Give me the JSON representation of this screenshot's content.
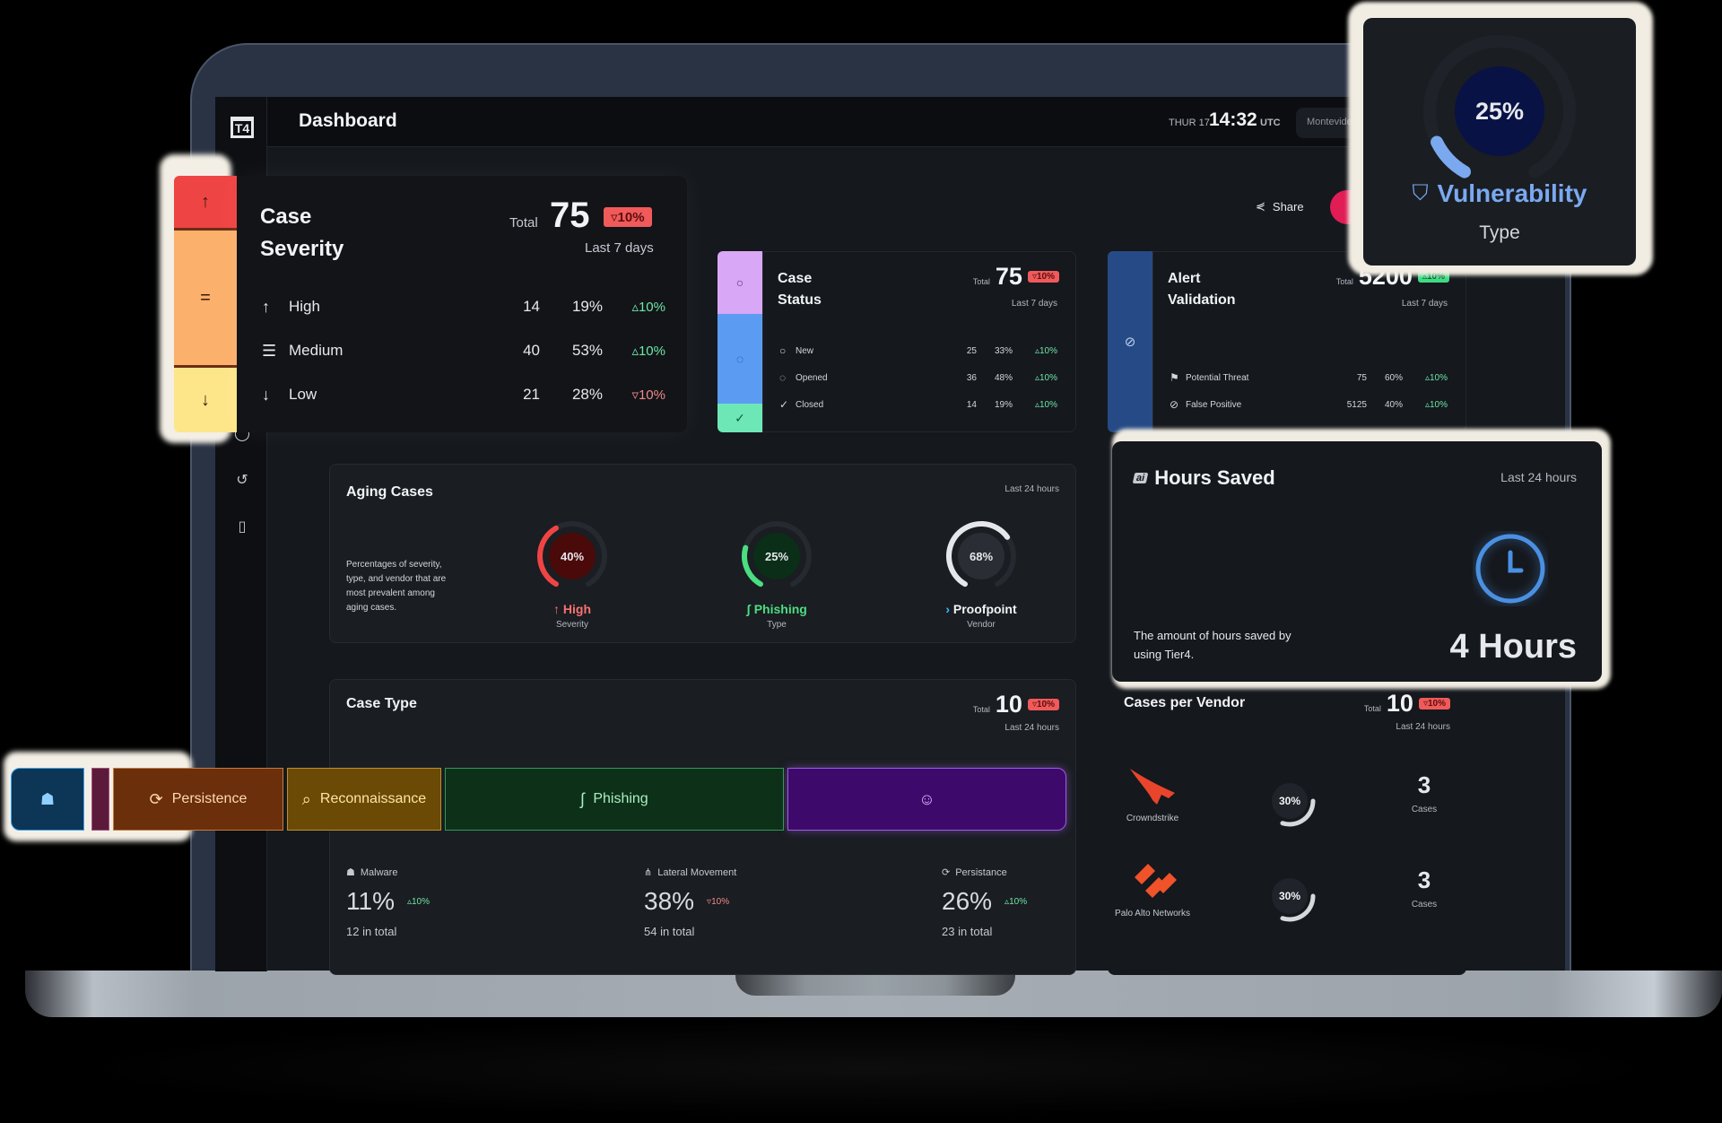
{
  "app": {
    "logo_text": "T4",
    "page_title": "Dashboard"
  },
  "header": {
    "day": "THUR 17",
    "time": "14:32",
    "timezone": "UTC",
    "location": "Montevideo,",
    "share_label": "Share",
    "download_icon": "download-icon"
  },
  "sidebar": {
    "icons": [
      "history-icon",
      "document-icon"
    ]
  },
  "case_severity": {
    "title_line1": "Case",
    "title_line2": "Severity",
    "total_label": "Total",
    "total": "75",
    "change": "▿10%",
    "period": "Last 7 days",
    "strip_colors": [
      "#ef4444",
      "#fbb06b",
      "#fde68a"
    ],
    "rows": [
      {
        "icon": "↑",
        "label": "High",
        "count": "14",
        "pct": "19%",
        "change": "▵10%",
        "dir": "up"
      },
      {
        "icon": "☰",
        "label": "Medium",
        "count": "40",
        "pct": "53%",
        "change": "▵10%",
        "dir": "up"
      },
      {
        "icon": "↓",
        "label": "Low",
        "count": "21",
        "pct": "28%",
        "change": "▿10%",
        "dir": "down"
      }
    ]
  },
  "case_status": {
    "title_line1": "Case",
    "title_line2": "Status",
    "total_label": "Total",
    "total": "75",
    "change": "▿10%",
    "period": "Last 7 days",
    "strip_colors": [
      "#d8a7f5",
      "#5b9cf2",
      "#6ee7b7"
    ],
    "rows": [
      {
        "icon": "○",
        "label": "New",
        "count": "25",
        "pct": "33%",
        "change": "▵10%"
      },
      {
        "icon": "◌",
        "label": "Opened",
        "count": "36",
        "pct": "48%",
        "change": "▵10%"
      },
      {
        "icon": "✓",
        "label": "Closed",
        "count": "14",
        "pct": "19%",
        "change": "▵10%"
      }
    ]
  },
  "alert_validation": {
    "title_line1": "Alert",
    "title_line2": "Validation",
    "total_label": "Total",
    "total": "5200",
    "change": "▵10%",
    "period": "Last 7 days",
    "rows": [
      {
        "icon": "⚑",
        "label": "Potential Threat",
        "count": "75",
        "pct": "60%",
        "change": "▵10%"
      },
      {
        "icon": "⊘",
        "label": "False Positive",
        "count": "5125",
        "pct": "40%",
        "change": "▵10%"
      }
    ]
  },
  "aging_cases": {
    "title": "Aging Cases",
    "period": "Last 24 hours",
    "description": "Percentages of severity, type, and vendor that are most prevalent among aging cases.",
    "gauges": [
      {
        "value": 40,
        "text": "40%",
        "label": "High",
        "icon": "↑",
        "sub": "Severity",
        "color": "#ef4444",
        "inner": "#4a0a0a",
        "label_color": "#f87171"
      },
      {
        "value": 25,
        "text": "25%",
        "label": "Phishing",
        "icon": "ʃ",
        "sub": "Type",
        "color": "#4ade80",
        "inner": "#0a2e18",
        "label_color": "#4ade80"
      },
      {
        "value": 68,
        "text": "68%",
        "label": "Proofpoint",
        "icon": "›",
        "sub": "Vendor",
        "color": "#e5e7eb",
        "inner": "#2a2d33",
        "label_color": "#f1f3f5"
      }
    ]
  },
  "hours_saved": {
    "title": "Hours Saved",
    "period": "Last 24 hours",
    "description": "The amount of hours saved by using Tier4.",
    "value": "4 Hours"
  },
  "case_type": {
    "title": "Case Type",
    "total_label": "Total",
    "total": "10",
    "change": "▿10%",
    "period": "Last 24 hours",
    "segments": [
      {
        "label": "",
        "icon": "ghost-icon",
        "glyph": "☗",
        "bg": "#0d3556",
        "border": "#3aa8f0",
        "color": "#8fd0ff"
      },
      {
        "label": "",
        "icon": "",
        "glyph": "",
        "bg": "#5c1a3a",
        "border": "#a0507a",
        "color": "#fff"
      },
      {
        "label": "Persistence",
        "icon": "refresh-icon",
        "glyph": "⟳",
        "bg": "#6b2f0c",
        "border": "#c47a3f",
        "color": "#ffd9b0"
      },
      {
        "label": "Reconnaissance",
        "icon": "search-icon",
        "glyph": "⌕",
        "bg": "#6b4a05",
        "border": "#b8902f",
        "color": "#ffe6a3"
      },
      {
        "label": "Phishing",
        "icon": "hook-icon",
        "glyph": "ʃ",
        "bg": "#0d3018",
        "border": "#2f9a55",
        "color": "#a8f0c0"
      },
      {
        "label": "",
        "icon": "robot-icon",
        "glyph": "☺",
        "bg": "#3d0a6b",
        "border": "#9b5ce0",
        "color": "#d9b8ff"
      }
    ],
    "stats": [
      {
        "icon": "☗",
        "label": "Malware",
        "pct": "11%",
        "change": "▵10%",
        "dir": "up",
        "total": "12",
        "total_suffix": "in total"
      },
      {
        "icon": "⋔",
        "label": "Lateral Movement",
        "pct": "38%",
        "change": "▿10%",
        "dir": "down",
        "total": "54",
        "total_suffix": "in total"
      },
      {
        "icon": "⟳",
        "label": "Persistance",
        "pct": "26%",
        "change": "▵10%",
        "dir": "up",
        "total": "23",
        "total_suffix": "in total"
      }
    ]
  },
  "cases_per_vendor": {
    "title": "Cases per Vendor",
    "total_label": "Total",
    "total": "10",
    "change": "▿10%",
    "period": "Last 24 hours",
    "vendors": [
      {
        "name": "Crowndstrike",
        "pct": 30,
        "pct_text": "30%",
        "cases": "3",
        "cases_label": "Cases",
        "logo_color": "#e8452c"
      },
      {
        "name": "Palo Alto Networks",
        "pct": 30,
        "pct_text": "30%",
        "cases": "3",
        "cases_label": "Cases",
        "logo_color": "#f0522a"
      }
    ]
  },
  "vulnerability": {
    "value": 25,
    "value_text": "25%",
    "label": "Vulnerability",
    "sub": "Type",
    "color": "#7aa9f0",
    "inner": "#081245"
  }
}
